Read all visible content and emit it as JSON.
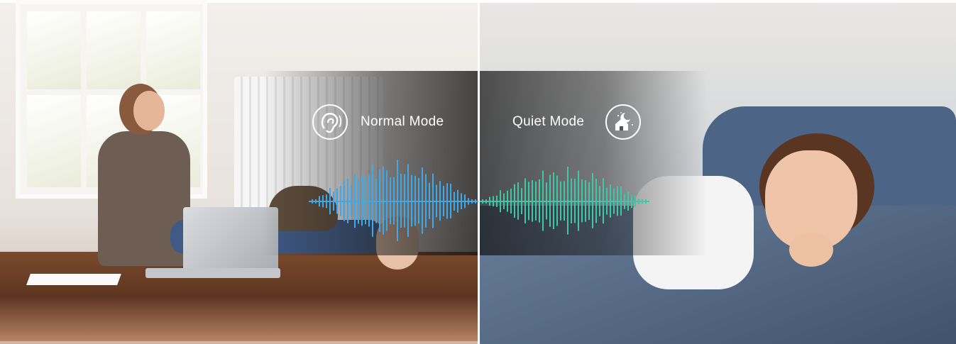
{
  "modes": {
    "normal": {
      "label": "Normal Mode",
      "icon": "ear-icon",
      "wave_color": "#3fa8e8"
    },
    "quiet": {
      "label": "Quiet Mode",
      "icon": "moon-house-icon",
      "wave_color": "#3fc7a8"
    }
  }
}
